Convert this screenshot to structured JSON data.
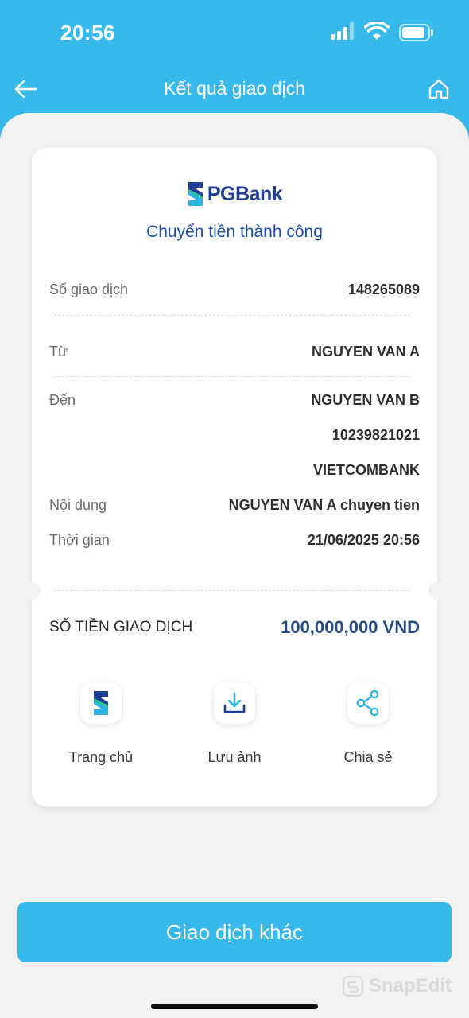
{
  "status_bar": {
    "time": "20:56"
  },
  "header": {
    "title": "Kết quả giao dịch"
  },
  "receipt": {
    "bank_name": "PGBank",
    "status_title": "Chuyển tiền thành công",
    "rows": {
      "transaction_no": {
        "label": "Số giao dịch",
        "value": "148265089"
      },
      "from": {
        "label": "Từ",
        "value": "NGUYEN VAN A"
      },
      "to": {
        "label": "Đến",
        "name": "NGUYEN VAN B",
        "account": "10239821021",
        "bank": "VIETCOMBANK"
      },
      "content": {
        "label": "Nội dung",
        "value": "NGUYEN VAN A chuyen tien"
      },
      "time": {
        "label": "Thời gian",
        "value": "21/06/2025 20:56"
      }
    },
    "amount": {
      "label": "SỐ TIỀN GIAO DỊCH",
      "value": "100,000,000 VND"
    },
    "actions": {
      "home": "Trang chủ",
      "save": "Lưu ảnh",
      "share": "Chia sẻ"
    }
  },
  "primary_button": {
    "label": "Giao dịch khác"
  },
  "watermark": "SnapEdit",
  "colors": {
    "header_blue": "#38b9ec",
    "brand_navy": "#1f3f95",
    "amount_blue": "#284b86",
    "background": "#f2f2f3"
  }
}
